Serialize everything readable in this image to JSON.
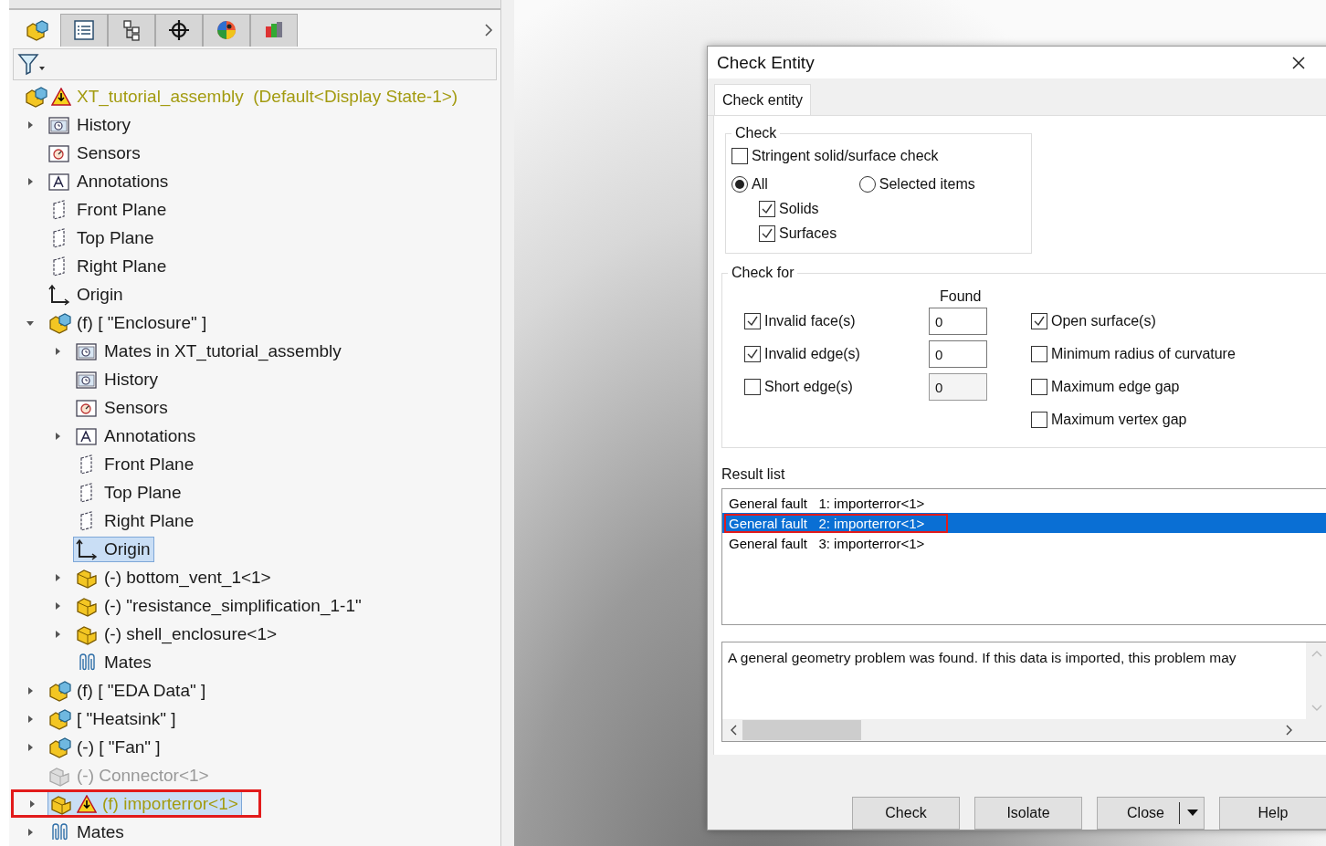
{
  "feature_tabs": [
    {
      "selected": true
    },
    {
      "selected": false
    },
    {
      "selected": false
    },
    {
      "selected": false
    },
    {
      "selected": false
    },
    {
      "selected": false
    }
  ],
  "tree": {
    "label": "XT_tutorial_assembly",
    "suffix": "(Default<Display State-1>)",
    "kind": "assembly",
    "warning": true,
    "selected": false,
    "children": [
      {
        "label": "History",
        "kind": "history",
        "expanded": false,
        "selected": false
      },
      {
        "label": "Sensors",
        "kind": "sensors",
        "selected": false
      },
      {
        "label": "Annotations",
        "kind": "annotations",
        "expanded": false,
        "selected": false
      },
      {
        "label": "Front Plane",
        "kind": "plane",
        "selected": false
      },
      {
        "label": "Top Plane",
        "kind": "plane",
        "selected": false
      },
      {
        "label": "Right Plane",
        "kind": "plane",
        "selected": false
      },
      {
        "label": "Origin",
        "kind": "origin",
        "selected": false
      },
      {
        "label": "(f) [ \"Enclosure\" ]",
        "kind": "assembly",
        "expanded": true,
        "selected": false,
        "children": [
          {
            "label": "Mates in XT_tutorial_assembly",
            "kind": "history",
            "expanded": false,
            "selected": false
          },
          {
            "label": "History",
            "kind": "history",
            "selected": false
          },
          {
            "label": "Sensors",
            "kind": "sensors",
            "selected": false
          },
          {
            "label": "Annotations",
            "kind": "annotations",
            "expanded": false,
            "selected": false
          },
          {
            "label": "Front Plane",
            "kind": "plane",
            "selected": false
          },
          {
            "label": "Top Plane",
            "kind": "plane",
            "selected": false
          },
          {
            "label": "Right Plane",
            "kind": "plane",
            "selected": false
          },
          {
            "label": "Origin",
            "kind": "origin",
            "selected": true
          },
          {
            "label": "(-) bottom_vent_1<1>",
            "kind": "part",
            "expanded": false,
            "selected": false
          },
          {
            "label": "(-) \"resistance_simplification_1-1\"",
            "kind": "part",
            "expanded": false,
            "selected": false
          },
          {
            "label": "(-) shell_enclosure<1>",
            "kind": "part",
            "expanded": false,
            "selected": false
          },
          {
            "label": "Mates",
            "kind": "mates",
            "selected": false
          }
        ]
      },
      {
        "label": "(f) [ \"EDA Data\" ]",
        "kind": "assembly",
        "expanded": false,
        "selected": false
      },
      {
        "label": "[ \"Heatsink\" ]",
        "kind": "assembly",
        "expanded": false,
        "selected": false
      },
      {
        "label": "(-) [ \"Fan\" ]",
        "kind": "assembly",
        "expanded": false,
        "selected": false
      },
      {
        "label": "(-) Connector<1>",
        "kind": "part",
        "suppressed": true,
        "selected": false
      },
      {
        "label": "(f) importerror<1>",
        "kind": "part",
        "warning": true,
        "expanded": false,
        "selected": true,
        "outlined": true
      },
      {
        "label": "Mates",
        "kind": "mates",
        "expanded": false,
        "selected": false
      }
    ]
  },
  "dialog": {
    "title": "Check Entity",
    "tabs": [
      {
        "label": "Check entity",
        "selected": true
      }
    ],
    "check_group": {
      "title": "Check",
      "stringent": {
        "label": "Stringent solid/surface check",
        "checked": false
      },
      "scope": [
        {
          "label": "All",
          "selected": true
        },
        {
          "label": "Selected items",
          "selected": false
        }
      ],
      "types": [
        {
          "label": "Solids",
          "checked": true
        },
        {
          "label": "Surfaces",
          "checked": true
        }
      ]
    },
    "check_for": {
      "title": "Check for",
      "found_header": "Found",
      "left": [
        {
          "label": "Invalid face(s)",
          "checked": true,
          "found": "0"
        },
        {
          "label": "Invalid edge(s)",
          "checked": true,
          "found": "0"
        },
        {
          "label": "Short edge(s)",
          "checked": false,
          "found": "0"
        }
      ],
      "right": [
        {
          "label": "Open surface(s)",
          "checked": true
        },
        {
          "label": "Minimum radius of curvature",
          "checked": false
        },
        {
          "label": "Maximum edge gap",
          "checked": false
        },
        {
          "label": "Maximum vertex gap",
          "checked": false
        }
      ]
    },
    "result_list": {
      "label": "Result list",
      "items": [
        {
          "type": "General fault",
          "target": "1: importerror<1>",
          "selected": false,
          "outlined": false
        },
        {
          "type": "General fault",
          "target": "2: importerror<1>",
          "selected": true,
          "outlined": true
        },
        {
          "type": "General fault",
          "target": "3: importerror<1>",
          "selected": false,
          "outlined": false
        }
      ]
    },
    "message": "A general geometry problem was found. If this data is imported, this problem may",
    "buttons": [
      {
        "label": "Check",
        "kind": "plain"
      },
      {
        "label": "Isolate",
        "kind": "plain"
      },
      {
        "label": "Close",
        "kind": "split"
      },
      {
        "label": "Help",
        "kind": "plain"
      }
    ]
  }
}
